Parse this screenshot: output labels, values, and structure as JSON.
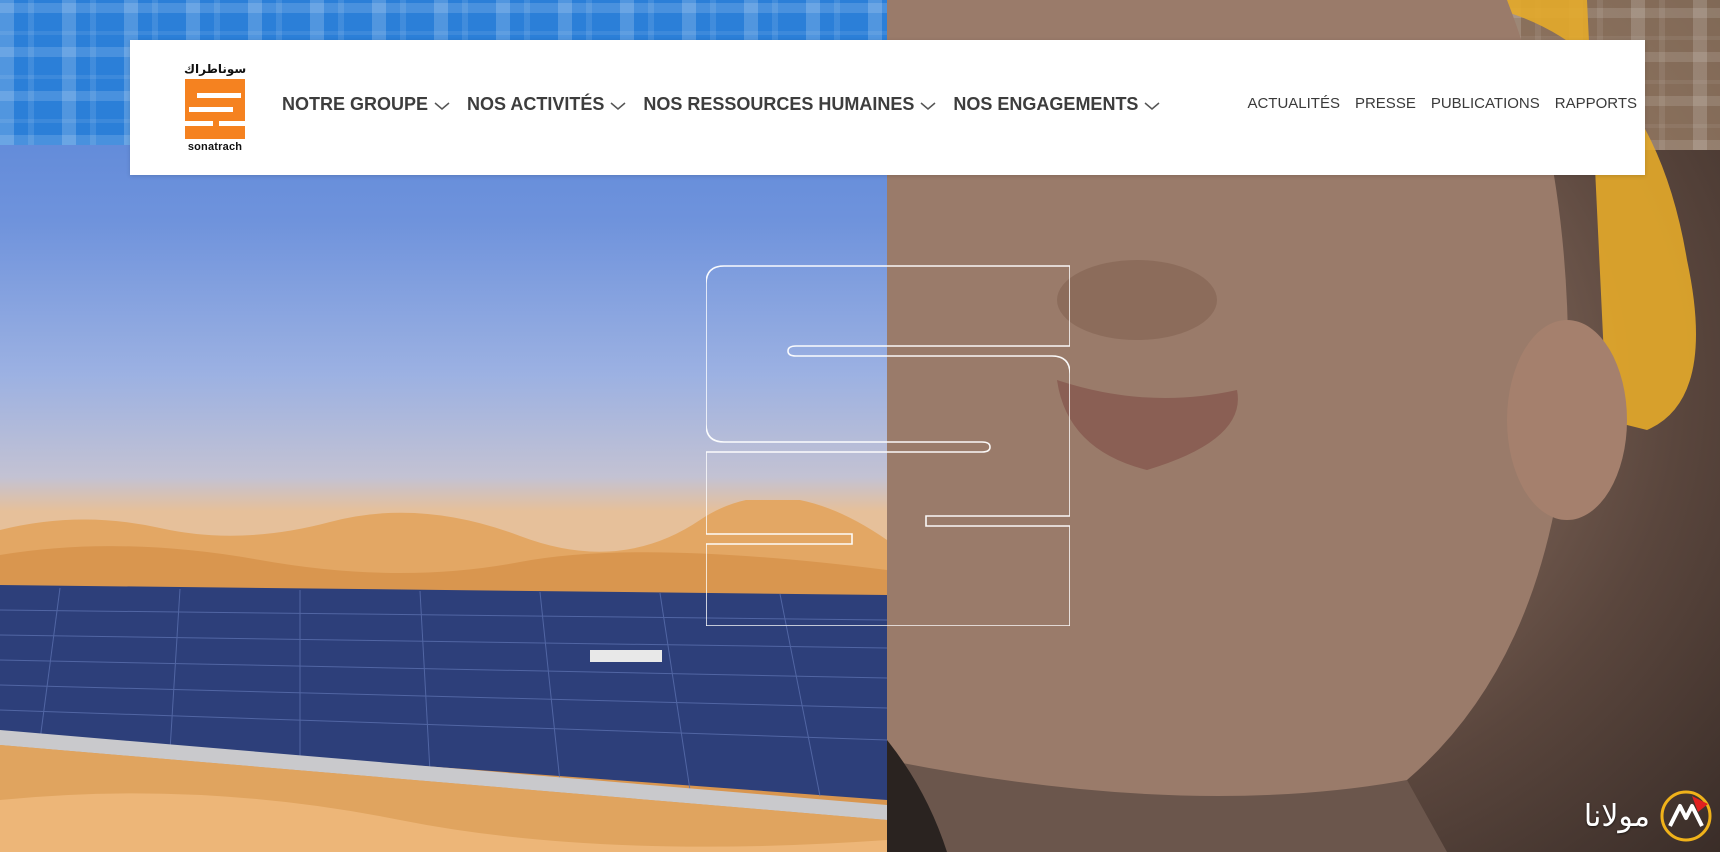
{
  "brand": {
    "name_arabic": "سوناطراك",
    "wordmark": "sonatrach",
    "accent_color": "#f58220"
  },
  "main_nav": [
    {
      "label": "NOTRE GROUPE",
      "icon": "chevron-down-icon"
    },
    {
      "label": "NOS ACTIVITÉS",
      "icon": "chevron-down-icon"
    },
    {
      "label": "NOS RESSOURCES HUMAINES",
      "icon": "chevron-down-icon"
    },
    {
      "label": "NOS ENGAGEMENTS",
      "icon": "chevron-down-icon"
    }
  ],
  "secondary_nav": [
    {
      "label": "ACTUALITÉS"
    },
    {
      "label": "PRESSE"
    },
    {
      "label": "PUBLICATIONS"
    },
    {
      "label": "RAPPORTS"
    }
  ],
  "hero": {
    "left_image": "solar-farm-in-desert",
    "right_image": "worker-face-with-hard-hat",
    "overlay_icon": "sonatrach-s-outline-icon"
  },
  "watermark": {
    "text": "مولانا",
    "icon": "mawlana-logo-icon"
  }
}
